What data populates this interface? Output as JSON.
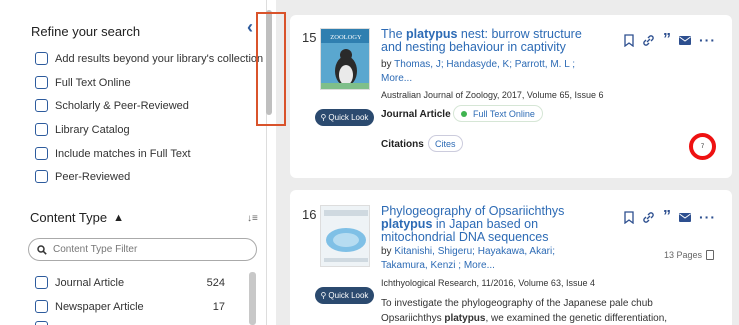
{
  "sidebar": {
    "heading": "Refine your search",
    "options": [
      "Add results beyond your library's collection",
      "Full Text Online",
      "Scholarly & Peer-Reviewed",
      "Library Catalog",
      "Include matches in Full Text",
      "Peer-Reviewed"
    ],
    "content_type": {
      "title": "Content Type",
      "filter_placeholder": "Content Type Filter",
      "items": [
        {
          "label": "Journal Article",
          "count": "524"
        },
        {
          "label": "Newspaper Article",
          "count": "17"
        }
      ]
    }
  },
  "results": [
    {
      "number": "15",
      "title_pre": "The ",
      "title_bold": "platypus",
      "title_post": " nest: burrow structure and nesting behaviour in captivity",
      "authors_prefix": "by ",
      "authors": "Thomas, J; Handasyde, K; Parrott, M. L ;",
      "more": "More...",
      "source": "Australian Journal of Zoology, 2017, Volume 65, Issue 6",
      "type": "Journal Article",
      "full_text": "Full Text Online",
      "citations_label": "Citations",
      "cites_label": "Cites",
      "quick_look": "Quick Look",
      "thumb_label": "ZOOLOGY",
      "altmetric": "7"
    },
    {
      "number": "16",
      "title_line1": "Phylogeography of Opsariichthys",
      "title_bold": "platypus",
      "title_post": " in Japan based on mitochondrial DNA sequences",
      "authors_prefix": "by ",
      "authors": "Kitanishi, Shigeru; Hayakawa, Akari;",
      "authors2": "Takamura, Kenzi ;",
      "more": "More...",
      "source": "Ichthyological Research, 11/2016, Volume 63, Issue 4",
      "pages": "13 Pages",
      "abstract_line1": "To investigate the phylogeography of the Japanese pale chub",
      "abstract_pre": "Opsariichthys ",
      "abstract_bold": "platypus",
      "abstract_post": ", we examined the genetic differentiation,",
      "quick_look": "Quick Look"
    }
  ],
  "colors": {
    "link": "#2d6bb5",
    "accent": "#2d5b9d",
    "quick_look_bg": "#2b4a6f",
    "altmetric": "#e11111",
    "highlight": "#d9532b"
  }
}
